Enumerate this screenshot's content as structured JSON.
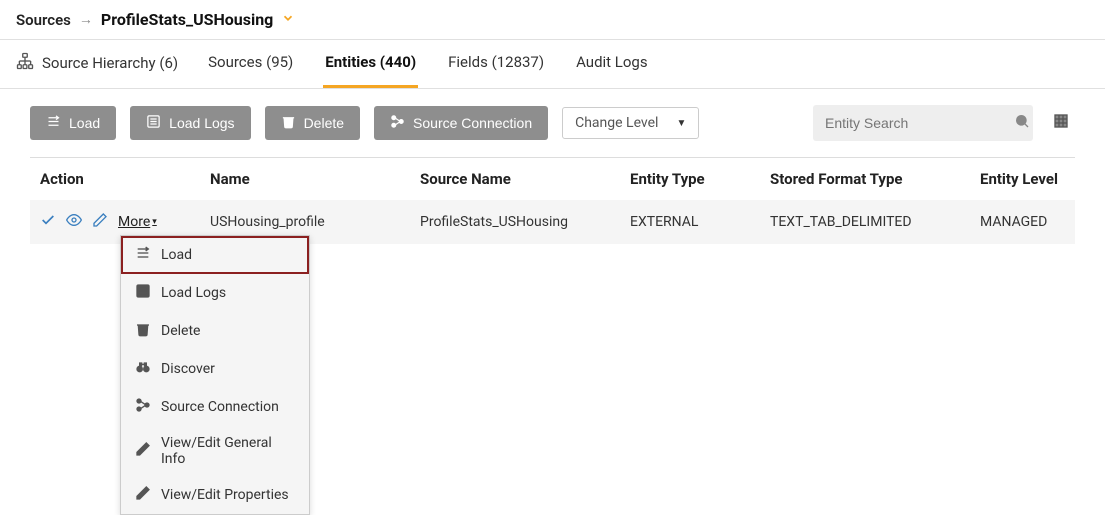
{
  "breadcrumb": {
    "root": "Sources",
    "current": "ProfileStats_USHousing"
  },
  "hierarchy": {
    "label": "Source Hierarchy (6)"
  },
  "tabs": [
    {
      "label": "Sources (95)",
      "active": false
    },
    {
      "label": "Entities (440)",
      "active": true
    },
    {
      "label": "Fields (12837)",
      "active": false
    },
    {
      "label": "Audit Logs",
      "active": false
    }
  ],
  "toolbar": {
    "load": "Load",
    "load_logs": "Load Logs",
    "delete": "Delete",
    "source_connection": "Source Connection",
    "change_level": "Change Level",
    "search_placeholder": "Entity Search"
  },
  "columns": {
    "action": "Action",
    "name": "Name",
    "source_name": "Source Name",
    "entity_type": "Entity Type",
    "stored_format_type": "Stored Format Type",
    "entity_level": "Entity Level"
  },
  "rows": [
    {
      "more": "More",
      "name": "USHousing_profile",
      "source_name": "ProfileStats_USHousing",
      "entity_type": "EXTERNAL",
      "stored_format_type": "TEXT_TAB_DELIMITED",
      "entity_level": "MANAGED"
    }
  ],
  "dropdown": {
    "load": "Load",
    "load_logs": "Load Logs",
    "delete": "Delete",
    "discover": "Discover",
    "source_connection": "Source Connection",
    "view_edit_general": "View/Edit General Info",
    "view_edit_properties": "View/Edit Properties"
  }
}
